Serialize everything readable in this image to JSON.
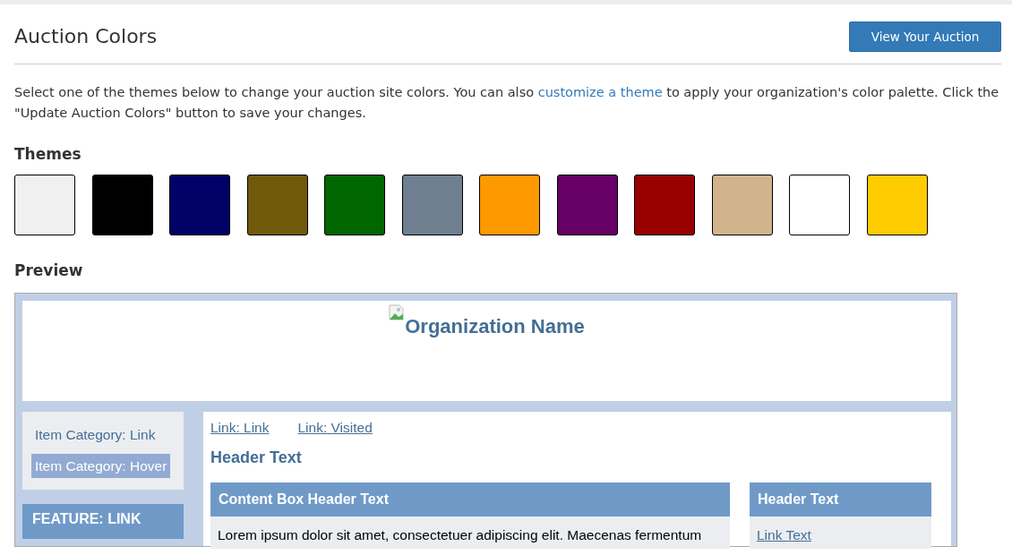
{
  "page": {
    "title": "Auction Colors",
    "view_button": "View Your Auction"
  },
  "intro": {
    "before": "Select one of the themes below to change your auction site colors. You can also ",
    "link": "customize a theme",
    "after": " to apply your organization's color palette. Click the \"Update Auction Colors\" button to save your changes."
  },
  "themes": {
    "heading": "Themes",
    "swatches": [
      {
        "color": "#f0f0f0"
      },
      {
        "color": "#000000"
      },
      {
        "color": "#000066"
      },
      {
        "color": "#705a0a"
      },
      {
        "color": "#006600"
      },
      {
        "color": "#708090"
      },
      {
        "color": "#ff9900"
      },
      {
        "color": "#660066"
      },
      {
        "color": "#990000"
      },
      {
        "color": "#d2b48c"
      },
      {
        "color": "#ffffff"
      },
      {
        "color": "#ffcc00"
      }
    ]
  },
  "preview": {
    "heading": "Preview",
    "org_name": "Organization Name",
    "categories": [
      {
        "label": "Item Category: Link",
        "hover": false
      },
      {
        "label": "Item Category: Hover",
        "hover": true
      }
    ],
    "feature": "FEATURE: LINK",
    "links": [
      "Link: Link",
      "Link: Visited"
    ],
    "header_text": "Header Text",
    "content_box": {
      "header": "Content Box Header Text",
      "body": "Lorem ipsum dolor sit amet, consectetuer adipiscing elit. Maecenas fermentum"
    },
    "side_box": {
      "header": "Header Text",
      "link": "Link Text"
    }
  }
}
